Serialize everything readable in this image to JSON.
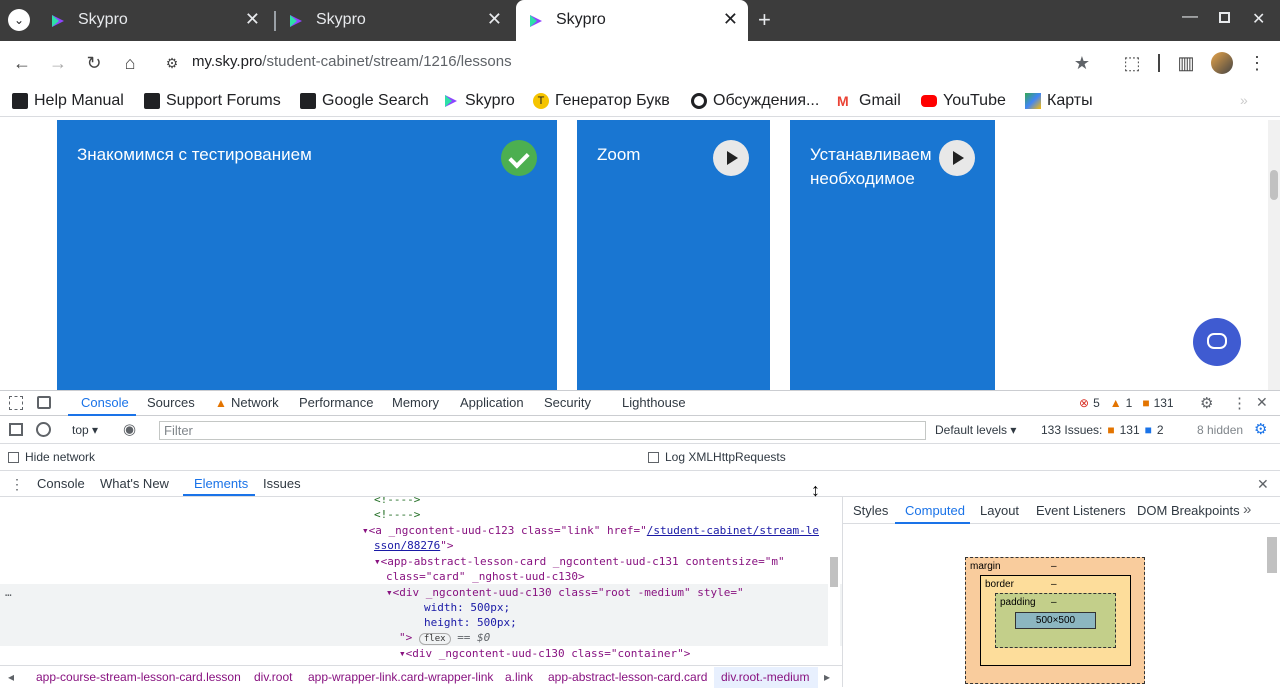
{
  "tabs": [
    {
      "title": "Skypro",
      "active": false
    },
    {
      "title": "Skypro",
      "active": false
    },
    {
      "title": "Skypro",
      "active": true
    }
  ],
  "toolbar": {
    "url_host": "my.sky.pro",
    "url_path": "/student-cabinet/stream/1216/lessons"
  },
  "bookmarks": [
    {
      "label": "Help Manual",
      "icon": "bookmark-icon"
    },
    {
      "label": "Support Forums",
      "icon": "bookmark-icon"
    },
    {
      "label": "Google Search",
      "icon": "bookmark-icon"
    },
    {
      "label": "Skypro",
      "icon": "skypro-icon"
    },
    {
      "label": "Генератор Букв",
      "icon": "t-icon"
    },
    {
      "label": "Обсуждения...",
      "icon": "discussion-icon"
    },
    {
      "label": "Gmail",
      "icon": "gmail-icon"
    },
    {
      "label": "YouTube",
      "icon": "youtube-icon"
    },
    {
      "label": "Карты",
      "icon": "maps-icon"
    }
  ],
  "lessons": [
    {
      "title": "Знакомимся с тестированием",
      "status": "completed"
    },
    {
      "title": "Zoom",
      "status": "play"
    },
    {
      "title": "Устанавливаем необходимое",
      "status": "play"
    }
  ],
  "devtools": {
    "main_tabs": [
      "Console",
      "Sources",
      "Network",
      "Performance",
      "Memory",
      "Application",
      "Security",
      "Lighthouse"
    ],
    "errors": "5",
    "warnings": "1",
    "issues_count": "131",
    "context": "top",
    "filter_placeholder": "Filter",
    "levels": "Default levels",
    "issues_summary": "133 Issues:",
    "issues_a": "131",
    "issues_b": "2",
    "hidden": "8 hidden",
    "hide_network": "Hide network",
    "log_xhr": "Log XMLHttpRequests",
    "drawer_tabs": [
      "Console",
      "What's New",
      "Elements",
      "Issues"
    ],
    "sidebar_tabs": [
      "Styles",
      "Computed",
      "Layout",
      "Event Listeners",
      "DOM Breakpoints"
    ],
    "box_model": {
      "margin": "margin",
      "border": "border",
      "padding": "padding",
      "content": "500×500",
      "dash": "–"
    },
    "breadcrumbs": [
      "app-course-stream-lesson-card.lesson",
      "div.root",
      "app-wrapper-link.card-wrapper-link",
      "a.link",
      "app-abstract-lesson-card.card",
      "div.root.-medium"
    ],
    "code": {
      "l0": "<!---->",
      "l1": "<!---->",
      "l2a": "<a _ngcontent-uud-c123 class=\"link\" href=\"",
      "l2b": "/student-cabinet/stream-le",
      "l3": "sson/88276",
      "l3b": "\">",
      "l4": "<app-abstract-lesson-card _ngcontent-uud-c131 contentsize=\"m\"",
      "l5": "class=\"card\" _nghost-uud-c130>",
      "l6": "<div _ngcontent-uud-c130 class=\"root -medium\" style=\"",
      "l7": "width: 500px;",
      "l8": "height: 500px;",
      "l9": "\">",
      "flex": "flex",
      "eq": "== $0",
      "l10": "<div _ngcontent-uud-c130 class=\"container\">"
    }
  }
}
